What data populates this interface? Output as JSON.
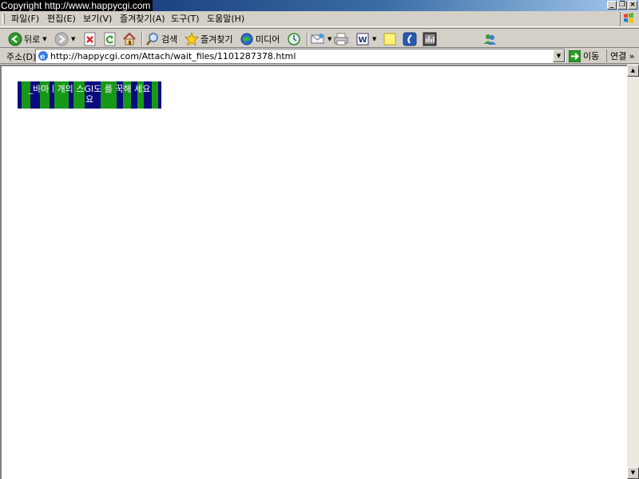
{
  "window": {
    "title": "Copyright   http://www.happycgi.com",
    "buttons": [
      "_",
      "❐",
      "×"
    ]
  },
  "menu": [
    "파일(F)",
    "편집(E)",
    "보기(V)",
    "즐겨찾기(A)",
    "도구(T)",
    "도움말(H)"
  ],
  "toolbar": {
    "back_label": "뒤로",
    "search_label": "검색",
    "favorites_label": "즐겨찾기",
    "media_label": "미디어"
  },
  "address": {
    "label": "주소(D)",
    "url": "http://happycgi.com/Attach/wait_files/1101287378.html",
    "go_label": "이동",
    "links_label": "연결 »"
  },
  "banner": {
    "line1": "_바마ㅣ개의 스GI도 를 꾹해 세요",
    "line2": "요"
  },
  "colors": {
    "banner_green": "#189818",
    "banner_navy": "#0a0a80",
    "title_gradient_start": "#0a246a"
  }
}
